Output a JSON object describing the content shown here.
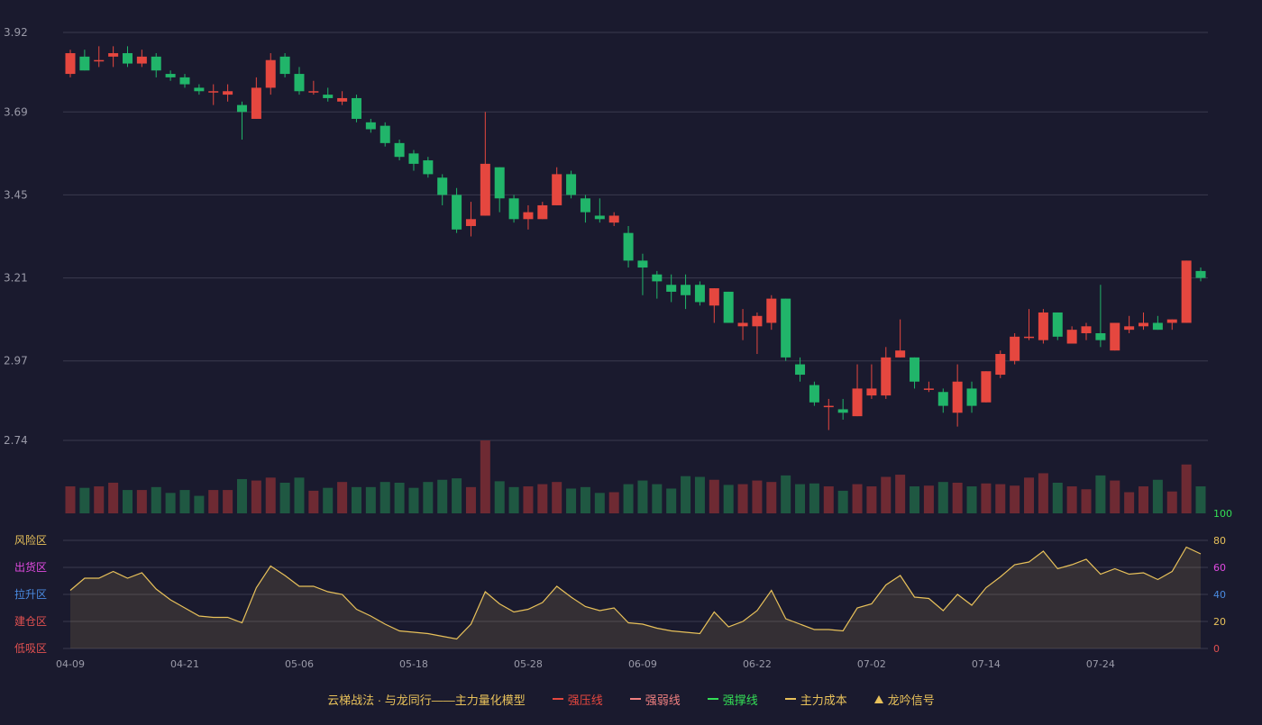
{
  "chart_data": {
    "type": "candlestick",
    "colors": {
      "up": "#e5473f",
      "down": "#21b56a",
      "vol_up": "#6e2a33",
      "vol_down": "#1f5842",
      "osc": "#e8c15a",
      "bg": "#1a1a2e",
      "grid": "#3a3a4e"
    },
    "x_ticks": [
      "04-09",
      "04-21",
      "05-06",
      "05-18",
      "05-28",
      "06-09",
      "06-22",
      "07-02",
      "07-14",
      "07-24"
    ],
    "y_ticks": [
      "3.92",
      "3.69",
      "3.45",
      "3.21",
      "2.97",
      "2.74"
    ],
    "price_range": [
      2.74,
      3.92
    ],
    "candles": [
      [
        3.8,
        3.86,
        3.87,
        3.79
      ],
      [
        3.85,
        3.81,
        3.87,
        3.81
      ],
      [
        3.84,
        3.84,
        3.88,
        3.82
      ],
      [
        3.85,
        3.86,
        3.88,
        3.82
      ],
      [
        3.86,
        3.83,
        3.88,
        3.82
      ],
      [
        3.83,
        3.85,
        3.87,
        3.82
      ],
      [
        3.85,
        3.81,
        3.86,
        3.79
      ],
      [
        3.8,
        3.79,
        3.81,
        3.78
      ],
      [
        3.79,
        3.77,
        3.8,
        3.76
      ],
      [
        3.76,
        3.75,
        3.77,
        3.74
      ],
      [
        3.75,
        3.75,
        3.77,
        3.71
      ],
      [
        3.74,
        3.75,
        3.77,
        3.72
      ],
      [
        3.71,
        3.69,
        3.72,
        3.61
      ],
      [
        3.67,
        3.76,
        3.79,
        3.67
      ],
      [
        3.76,
        3.84,
        3.86,
        3.74
      ],
      [
        3.85,
        3.8,
        3.86,
        3.79
      ],
      [
        3.8,
        3.75,
        3.82,
        3.74
      ],
      [
        3.75,
        3.75,
        3.78,
        3.74
      ],
      [
        3.74,
        3.73,
        3.76,
        3.72
      ],
      [
        3.72,
        3.73,
        3.75,
        3.71
      ],
      [
        3.73,
        3.67,
        3.74,
        3.66
      ],
      [
        3.66,
        3.64,
        3.67,
        3.63
      ],
      [
        3.65,
        3.6,
        3.66,
        3.59
      ],
      [
        3.6,
        3.56,
        3.61,
        3.55
      ],
      [
        3.57,
        3.54,
        3.58,
        3.52
      ],
      [
        3.55,
        3.51,
        3.56,
        3.5
      ],
      [
        3.5,
        3.45,
        3.51,
        3.42
      ],
      [
        3.45,
        3.35,
        3.47,
        3.34
      ],
      [
        3.36,
        3.38,
        3.43,
        3.33
      ],
      [
        3.39,
        3.54,
        3.69,
        3.39
      ],
      [
        3.53,
        3.44,
        3.53,
        3.4
      ],
      [
        3.44,
        3.38,
        3.45,
        3.37
      ],
      [
        3.38,
        3.4,
        3.42,
        3.35
      ],
      [
        3.38,
        3.42,
        3.43,
        3.38
      ],
      [
        3.42,
        3.51,
        3.53,
        3.42
      ],
      [
        3.51,
        3.45,
        3.52,
        3.44
      ],
      [
        3.44,
        3.4,
        3.45,
        3.37
      ],
      [
        3.39,
        3.38,
        3.44,
        3.37
      ],
      [
        3.37,
        3.39,
        3.4,
        3.36
      ],
      [
        3.34,
        3.26,
        3.36,
        3.24
      ],
      [
        3.26,
        3.24,
        3.28,
        3.16
      ],
      [
        3.22,
        3.2,
        3.23,
        3.15
      ],
      [
        3.19,
        3.17,
        3.22,
        3.14
      ],
      [
        3.19,
        3.16,
        3.22,
        3.12
      ],
      [
        3.19,
        3.14,
        3.2,
        3.13
      ],
      [
        3.13,
        3.18,
        3.18,
        3.08
      ],
      [
        3.17,
        3.08,
        3.17,
        3.08
      ],
      [
        3.07,
        3.08,
        3.12,
        3.03
      ],
      [
        3.07,
        3.1,
        3.11,
        2.99
      ],
      [
        3.08,
        3.15,
        3.16,
        3.06
      ],
      [
        3.15,
        2.98,
        3.15,
        2.97
      ],
      [
        2.96,
        2.93,
        2.98,
        2.91
      ],
      [
        2.9,
        2.85,
        2.91,
        2.84
      ],
      [
        2.84,
        2.84,
        2.86,
        2.77
      ],
      [
        2.83,
        2.82,
        2.86,
        2.8
      ],
      [
        2.81,
        2.89,
        2.96,
        2.81
      ],
      [
        2.87,
        2.89,
        2.96,
        2.86
      ],
      [
        2.87,
        2.98,
        3.01,
        2.86
      ],
      [
        2.98,
        3.0,
        3.09,
        2.98
      ],
      [
        2.98,
        2.91,
        2.98,
        2.89
      ],
      [
        2.89,
        2.89,
        2.91,
        2.88
      ],
      [
        2.88,
        2.84,
        2.89,
        2.82
      ],
      [
        2.82,
        2.91,
        2.96,
        2.78
      ],
      [
        2.89,
        2.84,
        2.91,
        2.82
      ],
      [
        2.85,
        2.94,
        2.94,
        2.85
      ],
      [
        2.93,
        2.99,
        3.0,
        2.92
      ],
      [
        2.97,
        3.04,
        3.05,
        2.96
      ],
      [
        3.04,
        3.04,
        3.12,
        3.03
      ],
      [
        3.03,
        3.11,
        3.12,
        3.02
      ],
      [
        3.11,
        3.04,
        3.11,
        3.03
      ],
      [
        3.02,
        3.06,
        3.07,
        3.02
      ],
      [
        3.05,
        3.07,
        3.08,
        3.03
      ],
      [
        3.05,
        3.03,
        3.19,
        3.01
      ],
      [
        3.0,
        3.08,
        3.08,
        3.0
      ],
      [
        3.06,
        3.07,
        3.1,
        3.05
      ],
      [
        3.07,
        3.08,
        3.11,
        3.06
      ],
      [
        3.08,
        3.06,
        3.1,
        3.06
      ],
      [
        3.08,
        3.09,
        3.09,
        3.06
      ],
      [
        3.08,
        3.26,
        3.26,
        3.08
      ],
      [
        3.23,
        3.21,
        3.24,
        3.2
      ]
    ],
    "volumes": [
      37,
      35,
      37,
      42,
      32,
      32,
      36,
      28,
      32,
      24,
      32,
      32,
      47,
      45,
      49,
      42,
      49,
      31,
      35,
      43,
      36,
      36,
      43,
      42,
      35,
      43,
      46,
      48,
      36,
      100,
      44,
      36,
      37,
      40,
      43,
      34,
      36,
      28,
      29,
      40,
      45,
      40,
      34,
      51,
      50,
      46,
      39,
      40,
      45,
      43,
      52,
      40,
      41,
      37,
      31,
      40,
      37,
      50,
      53,
      37,
      38,
      43,
      42,
      37,
      41,
      40,
      38,
      49,
      55,
      42,
      37,
      33,
      52,
      45,
      29,
      37,
      46,
      30,
      67,
      37
    ],
    "oscillator": [
      43,
      52,
      52,
      57,
      52,
      56,
      44,
      36,
      30,
      24,
      23,
      23,
      19,
      45,
      61,
      54,
      46,
      46,
      42,
      40,
      29,
      24,
      18,
      13,
      12,
      11,
      9,
      7,
      18,
      42,
      33,
      27,
      29,
      34,
      46,
      38,
      31,
      28,
      30,
      19,
      18,
      15,
      13,
      12,
      11,
      27,
      16,
      20,
      28,
      43,
      22,
      18,
      14,
      14,
      13,
      30,
      33,
      47,
      54,
      38,
      37,
      28,
      40,
      32,
      45,
      53,
      62,
      64,
      72,
      59,
      62,
      66,
      55,
      59,
      55,
      56,
      51,
      57,
      75,
      70
    ],
    "osc_range": [
      0,
      100
    ],
    "osc_ticks": [
      "100",
      "80",
      "60",
      "40",
      "20",
      "0"
    ],
    "osc_tick_colors": [
      "#33dd55",
      "#e8c15a",
      "#e04ae0",
      "#4a8ae0",
      "#e8c15a",
      "#e05050"
    ],
    "zones": [
      "风险区",
      "出货区",
      "拉升区",
      "建仓区",
      "低吸区"
    ],
    "zone_colors": [
      "#e8c15a",
      "#e04ae0",
      "#4a8ae0",
      "#e05050",
      "#e05050"
    ]
  },
  "legend": {
    "title": "云梯战法 · 与龙同行——主力量化模型",
    "items": [
      {
        "label": "强压线",
        "style": "line",
        "color": "#e5473f"
      },
      {
        "label": "强弱线",
        "style": "dash",
        "color": "#f08080"
      },
      {
        "label": "强撑线",
        "style": "line",
        "color": "#33dd55"
      },
      {
        "label": "主力成本",
        "style": "dash",
        "color": "#e8c15a"
      },
      {
        "label": "龙吟信号",
        "style": "triangle",
        "color": "#e8c15a"
      }
    ]
  }
}
